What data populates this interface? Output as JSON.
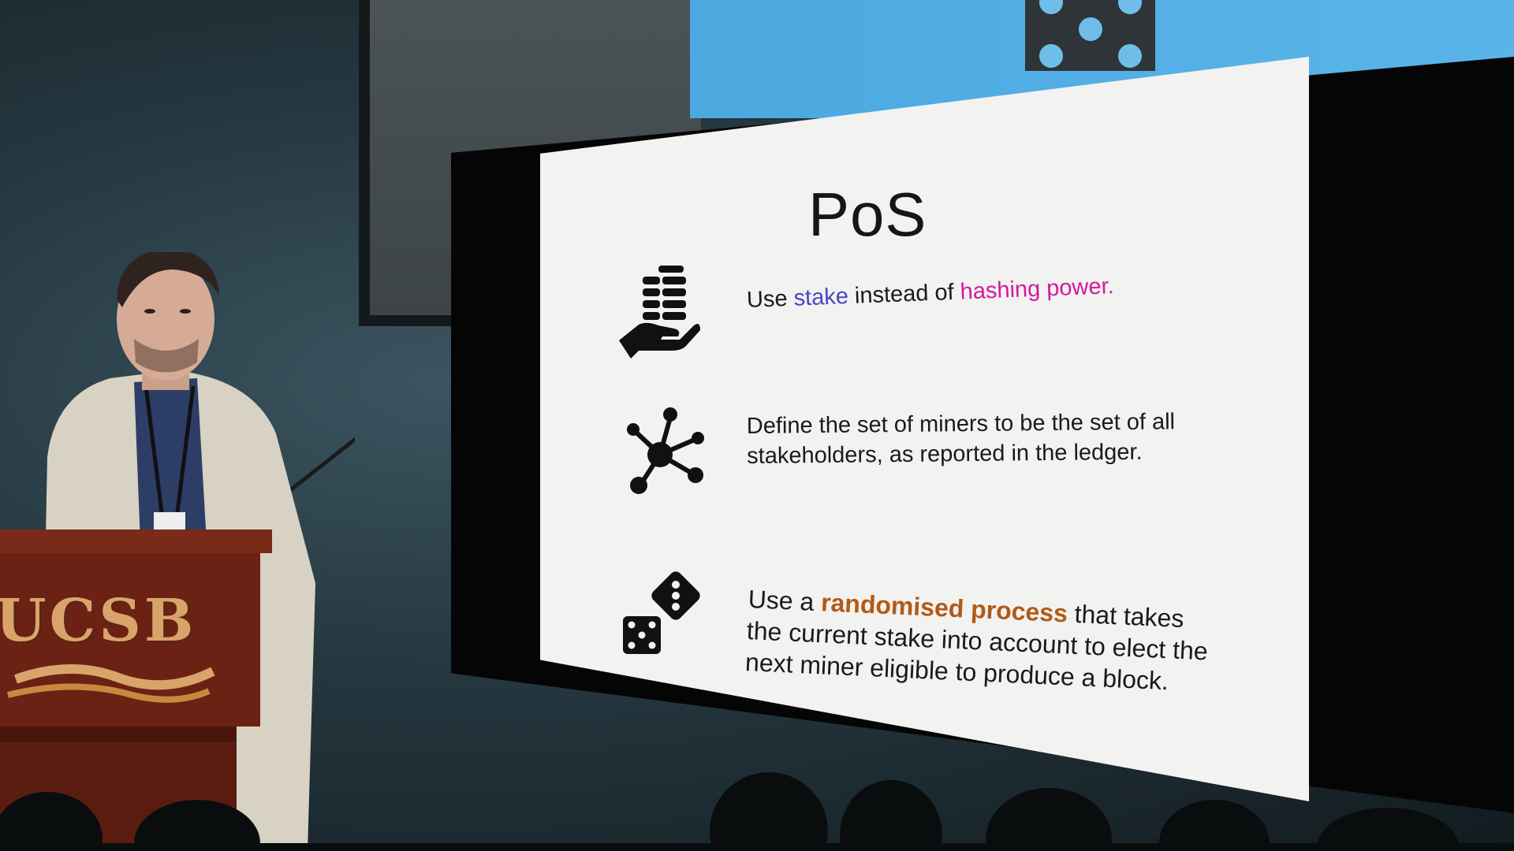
{
  "podium": {
    "logo_text": "UCSB"
  },
  "slide": {
    "title": "PoS",
    "points": [
      {
        "icon": "hand-holding-coins-icon",
        "prefix": "Use ",
        "highlight_1": "stake",
        "middle": " instead of ",
        "highlight_2": "hashing power",
        "suffix": "."
      },
      {
        "icon": "network-hub-icon",
        "text": "Define the set of miners to be the set of all stakeholders, as reported in the ledger."
      },
      {
        "icon": "dice-icon",
        "prefix": "Use a ",
        "highlight": "randomised process",
        "suffix": " that takes the current stake into account to elect the next miner eligible to produce a block."
      }
    ]
  },
  "colors": {
    "stake": "#4a46c4",
    "hashing_power": "#d4199c",
    "randomised_process": "#b25a16",
    "slide_background": "#f2f2f1",
    "podium_wood": "#6b2214",
    "logo_gold": "#d9a46a"
  }
}
